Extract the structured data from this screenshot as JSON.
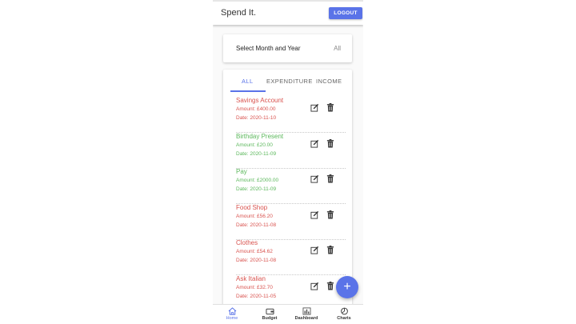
{
  "app": {
    "title": "Spend It.",
    "logout_label": "LOGOUT"
  },
  "filter": {
    "label": "Select Month and Year",
    "value": "All"
  },
  "tabs": [
    {
      "label": "ALL",
      "active": true
    },
    {
      "label": "EXPENDITURE",
      "active": false
    },
    {
      "label": "INCOME",
      "active": false
    }
  ],
  "transactions": [
    {
      "name": "Savings Account",
      "amount": "Amount: £400.00",
      "date": "Date: 2020-11-10",
      "type": "expenditure"
    },
    {
      "name": "Birthday Present",
      "amount": "Amount: £20.00",
      "date": "Date: 2020-11-09",
      "type": "income"
    },
    {
      "name": "Pay",
      "amount": "Amount: £2000.00",
      "date": "Date: 2020-11-09",
      "type": "income"
    },
    {
      "name": "Food Shop",
      "amount": "Amount: £56.20",
      "date": "Date: 2020-11-08",
      "type": "expenditure"
    },
    {
      "name": "Clothes",
      "amount": "Amount: £54.62",
      "date": "Date: 2020-11-08",
      "type": "expenditure"
    },
    {
      "name": "Ask Italian",
      "amount": "Amount: £32.70",
      "date": "Date: 2020-11-05",
      "type": "expenditure"
    }
  ],
  "fab": {
    "icon": "plus-icon",
    "symbol": "+"
  },
  "nav": [
    {
      "label": "Home",
      "icon": "home-icon",
      "active": true
    },
    {
      "label": "Budget",
      "icon": "wallet-icon",
      "active": false
    },
    {
      "label": "Dashboard",
      "icon": "bar-chart-icon",
      "active": false
    },
    {
      "label": "Charts",
      "icon": "pie-chart-icon",
      "active": false
    }
  ],
  "colors": {
    "accent": "#5a73e8",
    "expenditure": "#d9534f",
    "income": "#5cb85c"
  }
}
